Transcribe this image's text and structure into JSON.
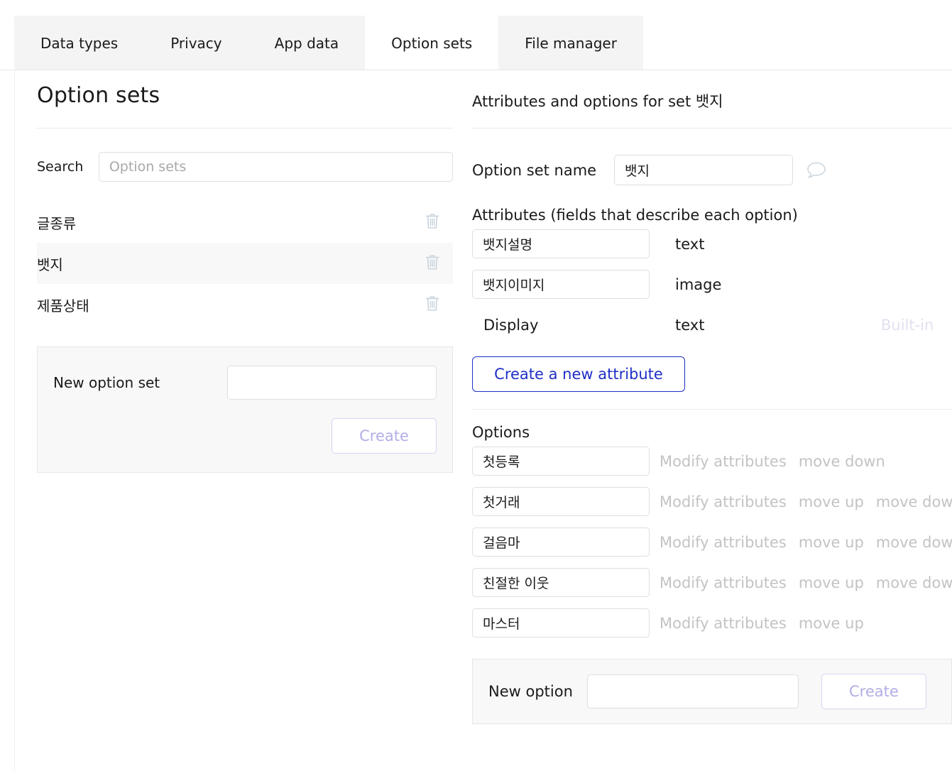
{
  "tabs": [
    {
      "label": "Data types",
      "active": false
    },
    {
      "label": "Privacy",
      "active": false
    },
    {
      "label": "App data",
      "active": false
    },
    {
      "label": "Option sets",
      "active": true
    },
    {
      "label": "File manager",
      "active": false
    }
  ],
  "left": {
    "title": "Option sets",
    "search_label": "Search",
    "search_value": "",
    "search_placeholder": "Option sets",
    "sets": [
      {
        "name": "글종류",
        "selected": false,
        "delete_icon": "trash-icon"
      },
      {
        "name": "뱃지",
        "selected": true,
        "delete_icon": "trash-icon"
      },
      {
        "name": "제품상태",
        "selected": false,
        "delete_icon": "trash-icon"
      }
    ],
    "new_set": {
      "label": "New option set",
      "value": "",
      "placeholder": "",
      "create_label": "Create",
      "create_disabled": true
    }
  },
  "right": {
    "title": "Attributes and options for set 뱃지",
    "option_set_name_label": "Option set name",
    "option_set_name_value": "뱃지",
    "comment_icon": "speech-bubble-icon",
    "attributes_heading": "Attributes (fields that describe each option)",
    "attributes": [
      {
        "name": "뱃지설명",
        "type": "text",
        "editable": true,
        "builtin": ""
      },
      {
        "name": "뱃지이미지",
        "type": "image",
        "editable": true,
        "builtin": ""
      },
      {
        "name": "Display",
        "type": "text",
        "editable": false,
        "builtin": "Built-in"
      }
    ],
    "create_attribute_label": "Create a new attribute",
    "options_heading": "Options",
    "options": [
      {
        "name": "첫등록",
        "actions": [
          "Modify attributes",
          "move down"
        ]
      },
      {
        "name": "첫거래",
        "actions": [
          "Modify attributes",
          "move up",
          "move down"
        ]
      },
      {
        "name": "걸음마",
        "actions": [
          "Modify attributes",
          "move up",
          "move down"
        ]
      },
      {
        "name": "친절한 이웃",
        "actions": [
          "Modify attributes",
          "move up",
          "move down"
        ]
      },
      {
        "name": "마스터",
        "actions": [
          "Modify attributes",
          "move up"
        ]
      }
    ],
    "new_option": {
      "label": "New option",
      "value": "",
      "placeholder": "",
      "create_label": "Create",
      "create_disabled": true
    }
  },
  "colors": {
    "tab_inactive_bg": "#f4f4f4",
    "tab_active_bg": "#ffffff",
    "accent_blue": "#1f2fc6",
    "disabled_lavender": "#b2aee6",
    "muted_link": "#c3c3c3",
    "trash_icon": "#ccd6de",
    "panel_bg": "#f8f8f8"
  }
}
